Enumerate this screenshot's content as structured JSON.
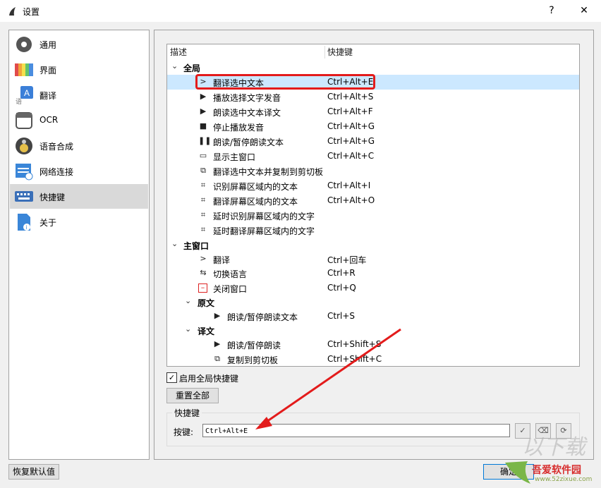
{
  "window": {
    "title": "设置",
    "help_label": "?",
    "close_label": "✕"
  },
  "sidebar": {
    "items": [
      {
        "label": "通用",
        "icon": "gear-icon"
      },
      {
        "label": "界面",
        "icon": "palette-icon"
      },
      {
        "label": "翻译",
        "icon": "translate-icon"
      },
      {
        "label": "OCR",
        "icon": "ocr-icon"
      },
      {
        "label": "语音合成",
        "icon": "speaker-icon"
      },
      {
        "label": "网络连接",
        "icon": "network-icon"
      },
      {
        "label": "快捷键",
        "icon": "keyboard-icon"
      },
      {
        "label": "关于",
        "icon": "info-icon"
      }
    ],
    "selected_label": "快捷键"
  },
  "tree": {
    "header": {
      "description": "描述",
      "shortcut": "快捷键"
    },
    "groups": {
      "global": "全局",
      "main_window": "主窗口",
      "source": "原文",
      "translation": "译文"
    },
    "rows": [
      {
        "label": "翻译选中文本",
        "key": "Ctrl+Alt+E",
        "icon": "chevron-right-icon"
      },
      {
        "label": "播放选择文字发音",
        "key": "Ctrl+Alt+S",
        "icon": "play-icon"
      },
      {
        "label": "朗读选中文本译文",
        "key": "Ctrl+Alt+F",
        "icon": "play-icon"
      },
      {
        "label": "停止播放发音",
        "key": "Ctrl+Alt+G",
        "icon": "stop-icon"
      },
      {
        "label": "朗读/暂停朗读文本",
        "key": "Ctrl+Alt+G",
        "icon": "pause-icon"
      },
      {
        "label": "显示主窗口",
        "key": "Ctrl+Alt+C",
        "icon": "window-icon"
      },
      {
        "label": "翻译选中文本并复制到剪切板",
        "key": "",
        "icon": "copy-icon"
      },
      {
        "label": "识别屏幕区域内的文本",
        "key": "Ctrl+Alt+I",
        "icon": "crop-icon"
      },
      {
        "label": "翻译屏幕区域内的文本",
        "key": "Ctrl+Alt+O",
        "icon": "crop-icon"
      },
      {
        "label": "延时识别屏幕区域内的文字",
        "key": "",
        "icon": "crop-icon"
      },
      {
        "label": "延时翻译屏幕区域内的文字",
        "key": "",
        "icon": "crop-icon"
      },
      {
        "label": "翻译",
        "key": "Ctrl+回车",
        "icon": "chevron-right-icon"
      },
      {
        "label": "切换语言",
        "key": "Ctrl+R",
        "icon": "swap-icon"
      },
      {
        "label": "关闭窗口",
        "key": "Ctrl+Q",
        "icon": "close-window-icon"
      },
      {
        "label": "朗读/暂停朗读文本",
        "key": "Ctrl+S",
        "icon": "play-icon"
      },
      {
        "label": "朗读/暂停朗读",
        "key": "Ctrl+Shift+S",
        "icon": "play-icon"
      },
      {
        "label": "复制到剪切板",
        "key": "Ctrl+Shift+C",
        "icon": "copy-icon"
      }
    ]
  },
  "global_toggle": {
    "label": "启用全局快捷键",
    "checked": true,
    "mark": "✓"
  },
  "reset_all_label": "重置全部",
  "shortcut_group": {
    "title": "快捷键",
    "key_label": "按键:",
    "value": "Ctrl+Alt+E"
  },
  "footer": {
    "restore_defaults_label": "恢复默认值",
    "ok_label": "确定"
  },
  "watermark": {
    "text": "吾爱软件园",
    "url": "www.52zixue.com"
  },
  "colors": {
    "highlight": "#cce8ff",
    "annotation_red": "#e31b1b",
    "selected_side": "#d9d9d9"
  }
}
